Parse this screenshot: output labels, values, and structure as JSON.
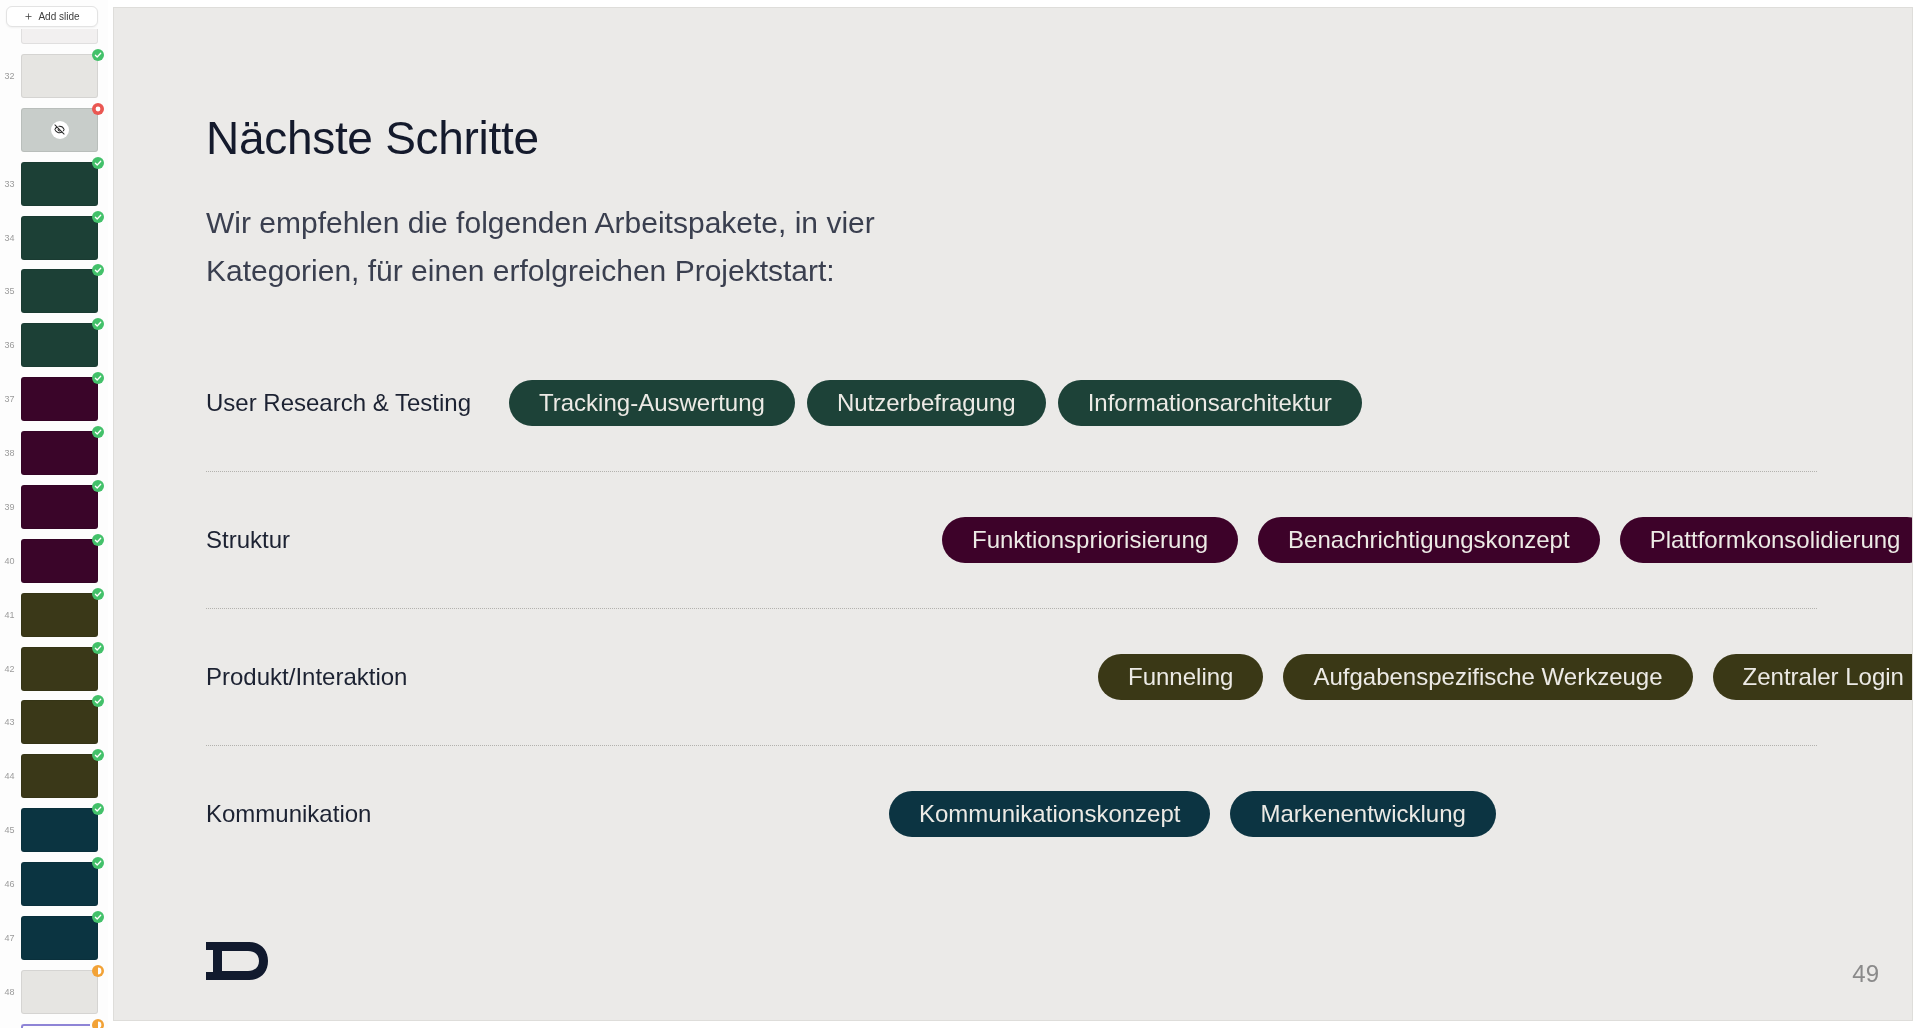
{
  "sidebar": {
    "add_button": {
      "label": "Add slide"
    },
    "slides": [
      {
        "color": "#f2f0f0",
        "hidden": false,
        "selected": false
      },
      {
        "number": "32",
        "color": "#e6e5e2",
        "badge": {
          "kind": "check",
          "color": "#43c16a"
        },
        "hidden": false,
        "selected": false
      },
      {
        "color": "#c8cdca",
        "badge": {
          "kind": "dot",
          "color": "#ea5752"
        },
        "hidden": true,
        "selected": false
      },
      {
        "number": "33",
        "color": "#1c4036",
        "badge": {
          "kind": "check",
          "color": "#43c16a"
        },
        "hidden": false,
        "selected": false
      },
      {
        "number": "34",
        "color": "#1c4036",
        "badge": {
          "kind": "check",
          "color": "#43c16a"
        },
        "hidden": false,
        "selected": false
      },
      {
        "number": "35",
        "color": "#1c4036",
        "badge": {
          "kind": "check",
          "color": "#43c16a"
        },
        "hidden": false,
        "selected": false
      },
      {
        "number": "36",
        "color": "#1c4036",
        "badge": {
          "kind": "check",
          "color": "#43c16a"
        },
        "hidden": false,
        "selected": false
      },
      {
        "number": "37",
        "color": "#3a0529",
        "badge": {
          "kind": "check",
          "color": "#43c16a"
        },
        "hidden": false,
        "selected": false
      },
      {
        "number": "38",
        "color": "#3a0529",
        "badge": {
          "kind": "check",
          "color": "#43c16a"
        },
        "hidden": false,
        "selected": false
      },
      {
        "number": "39",
        "color": "#3a0529",
        "badge": {
          "kind": "check",
          "color": "#43c16a"
        },
        "hidden": false,
        "selected": false
      },
      {
        "number": "40",
        "color": "#3a0529",
        "badge": {
          "kind": "check",
          "color": "#43c16a"
        },
        "hidden": false,
        "selected": false
      },
      {
        "number": "41",
        "color": "#3a3818",
        "badge": {
          "kind": "check",
          "color": "#43c16a"
        },
        "hidden": false,
        "selected": false
      },
      {
        "number": "42",
        "color": "#3a3818",
        "badge": {
          "kind": "check",
          "color": "#43c16a"
        },
        "hidden": false,
        "selected": false
      },
      {
        "number": "43",
        "color": "#3a3818",
        "badge": {
          "kind": "check",
          "color": "#43c16a"
        },
        "hidden": false,
        "selected": false
      },
      {
        "number": "44",
        "color": "#3a3818",
        "badge": {
          "kind": "check",
          "color": "#43c16a"
        },
        "hidden": false,
        "selected": false
      },
      {
        "number": "45",
        "color": "#0b3441",
        "badge": {
          "kind": "check",
          "color": "#43c16a"
        },
        "hidden": false,
        "selected": false
      },
      {
        "number": "46",
        "color": "#0b3441",
        "badge": {
          "kind": "check",
          "color": "#43c16a"
        },
        "hidden": false,
        "selected": false
      },
      {
        "number": "47",
        "color": "#0b3441",
        "badge": {
          "kind": "check",
          "color": "#43c16a"
        },
        "hidden": false,
        "selected": false
      },
      {
        "number": "48",
        "color": "#e6e5e2",
        "badge": {
          "kind": "half",
          "color": "#f2a236"
        },
        "hidden": false,
        "selected": false
      },
      {
        "badge": {
          "kind": "half",
          "color": "#f2a236"
        },
        "hidden": false,
        "selected": true
      }
    ]
  },
  "slide": {
    "title": "Nächste Schritte",
    "intro": "Wir empfehlen die folgenden Arbeitspakete, in vier Kategorien, für einen erfolgreichen Projektstart:",
    "categories": [
      {
        "label": "User Research & Testing",
        "color": "#1d4238",
        "packages": [
          "Tracking-Auswertung",
          "Nutzerbefragung",
          "Informationsarchitektur"
        ]
      },
      {
        "label": "Struktur",
        "color": "#3d0229",
        "packages": [
          "Funktionspriorisierung",
          "Benachrichtigungskonzept",
          "Plattformkonsolidierung"
        ]
      },
      {
        "label": "Produkt/Interaktion",
        "color": "#3a3816",
        "packages": [
          "Funneling",
          "Aufgabenspezifische Werkzeuge",
          "Zentraler Login"
        ]
      },
      {
        "label": "Kommunikation",
        "color": "#0c3442",
        "packages": [
          "Kommunikationskonzept",
          "Markenentwicklung"
        ]
      }
    ],
    "page_number": "49"
  }
}
